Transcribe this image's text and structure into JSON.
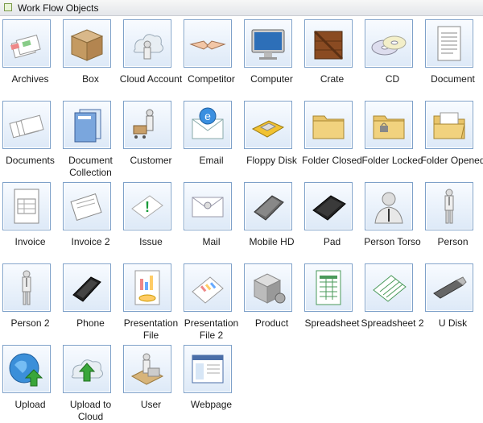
{
  "panel": {
    "title": "Work Flow Objects"
  },
  "items": [
    {
      "label": "Archives",
      "icon": "archives-icon"
    },
    {
      "label": "Box",
      "icon": "box-icon"
    },
    {
      "label": "Cloud Account",
      "icon": "cloud-account-icon"
    },
    {
      "label": "Competitor",
      "icon": "competitor-icon"
    },
    {
      "label": "Computer",
      "icon": "computer-icon"
    },
    {
      "label": "Crate",
      "icon": "crate-icon"
    },
    {
      "label": "CD",
      "icon": "cd-icon"
    },
    {
      "label": "Document",
      "icon": "document-icon"
    },
    {
      "label": "Documents",
      "icon": "documents-icon"
    },
    {
      "label": "Document Collection",
      "icon": "document-collection-icon"
    },
    {
      "label": "Customer",
      "icon": "customer-icon"
    },
    {
      "label": "Email",
      "icon": "email-icon"
    },
    {
      "label": "Floppy Disk",
      "icon": "floppy-disk-icon"
    },
    {
      "label": "Folder Closed",
      "icon": "folder-closed-icon"
    },
    {
      "label": "Folder Locked",
      "icon": "folder-locked-icon"
    },
    {
      "label": "Folder Opened",
      "icon": "folder-opened-icon"
    },
    {
      "label": "Invoice",
      "icon": "invoice-icon"
    },
    {
      "label": "Invoice 2",
      "icon": "invoice-2-icon"
    },
    {
      "label": "Issue",
      "icon": "issue-icon"
    },
    {
      "label": "Mail",
      "icon": "mail-icon"
    },
    {
      "label": "Mobile HD",
      "icon": "mobile-hd-icon"
    },
    {
      "label": "Pad",
      "icon": "pad-icon"
    },
    {
      "label": "Person Torso",
      "icon": "person-torso-icon"
    },
    {
      "label": "Person",
      "icon": "person-icon"
    },
    {
      "label": "Person 2",
      "icon": "person-2-icon"
    },
    {
      "label": "Phone",
      "icon": "phone-icon"
    },
    {
      "label": "Presentation File",
      "icon": "presentation-file-icon"
    },
    {
      "label": "Presentation File 2",
      "icon": "presentation-file-2-icon"
    },
    {
      "label": "Product",
      "icon": "product-icon"
    },
    {
      "label": "Spreadsheet",
      "icon": "spreadsheet-icon"
    },
    {
      "label": "Spreadsheet 2",
      "icon": "spreadsheet-2-icon"
    },
    {
      "label": "U Disk",
      "icon": "u-disk-icon"
    },
    {
      "label": "Upload",
      "icon": "upload-icon"
    },
    {
      "label": "Upload to Cloud",
      "icon": "upload-to-cloud-icon"
    },
    {
      "label": "User",
      "icon": "user-icon"
    },
    {
      "label": "Webpage",
      "icon": "webpage-icon"
    }
  ]
}
